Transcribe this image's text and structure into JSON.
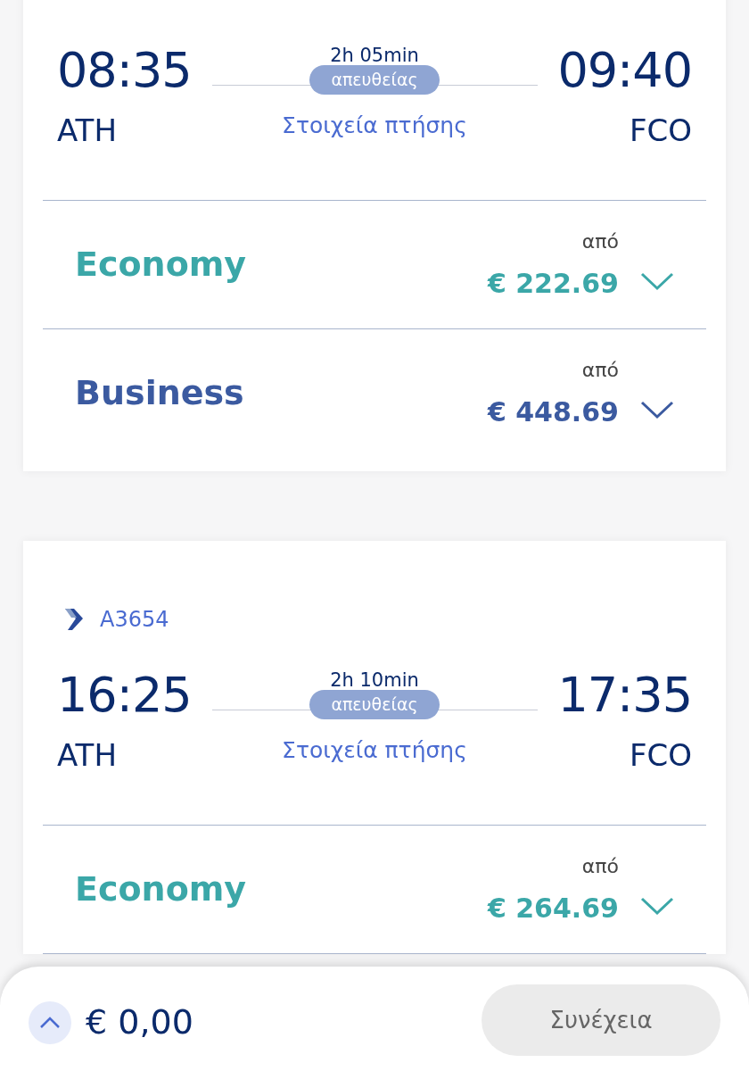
{
  "flights": [
    {
      "depart_time": "08:35",
      "arrive_time": "09:40",
      "depart_code": "ATH",
      "arrive_code": "FCO",
      "duration": "2h 05min",
      "stops": "απευθείας",
      "details_link": "Στοιχεία πτήσης",
      "fares": [
        {
          "cabin": "Economy",
          "from": "από",
          "price": "€ 222.69",
          "color": "#3ba7a8"
        },
        {
          "cabin": "Business",
          "from": "από",
          "price": "€ 448.69",
          "color": "#3b5aa0"
        }
      ]
    },
    {
      "flight_number": "A3654",
      "depart_time": "16:25",
      "arrive_time": "17:35",
      "depart_code": "ATH",
      "arrive_code": "FCO",
      "duration": "2h 10min",
      "stops": "απευθείας",
      "details_link": "Στοιχεία πτήσης",
      "fares": [
        {
          "cabin": "Economy",
          "from": "από",
          "price": "€ 264.69",
          "color": "#3ba7a8"
        }
      ]
    }
  ],
  "summary": {
    "total": "€ 0,00",
    "continue_button": "Συνέχεια",
    "continue_disabled": true
  }
}
